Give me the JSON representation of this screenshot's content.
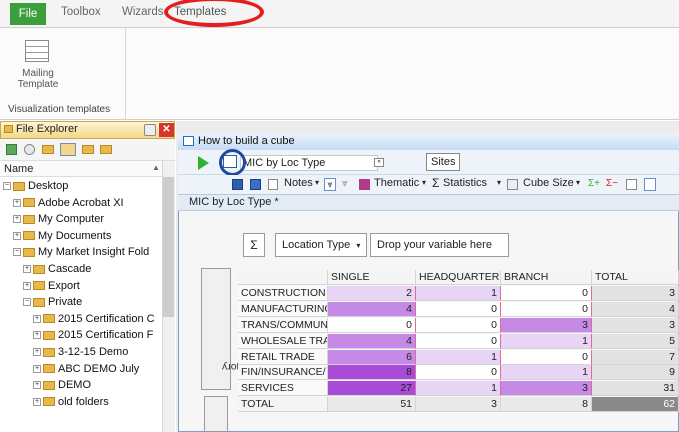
{
  "ribbon": {
    "tabs": [
      "File",
      "Toolbox",
      "Wizards",
      "Templates"
    ],
    "mailing_template_label": "Mailing Template",
    "group_label": "Visualization templates"
  },
  "file_explorer": {
    "title": "File Explorer",
    "column_header": "Name",
    "items": [
      {
        "label": "Desktop",
        "indent": 0,
        "expander": "−"
      },
      {
        "label": "Adobe Acrobat XI",
        "indent": 1,
        "expander": "+"
      },
      {
        "label": "My Computer",
        "indent": 1,
        "expander": "+"
      },
      {
        "label": "My Documents",
        "indent": 1,
        "expander": "+"
      },
      {
        "label": "My Market Insight Fold",
        "indent": 1,
        "expander": "−"
      },
      {
        "label": "Cascade",
        "indent": 2,
        "expander": "+"
      },
      {
        "label": "Export",
        "indent": 2,
        "expander": "+"
      },
      {
        "label": "Private",
        "indent": 2,
        "expander": "−"
      },
      {
        "label": "2015 Certification C",
        "indent": 3,
        "expander": "+"
      },
      {
        "label": "2015 Certification F",
        "indent": 3,
        "expander": "+"
      },
      {
        "label": "3-12-15 Demo",
        "indent": 3,
        "expander": "+"
      },
      {
        "label": "ABC DEMO July",
        "indent": 3,
        "expander": "+"
      },
      {
        "label": "DEMO",
        "indent": 3,
        "expander": "+"
      },
      {
        "label": "old folders",
        "indent": 3,
        "expander": "+"
      }
    ]
  },
  "cube_window": {
    "title": "How to build a cube",
    "cube_name": "MIC by Loc Type",
    "sites_button": "Sites",
    "toolbar": {
      "notes": "Notes",
      "thematic": "Thematic",
      "statistics": "Statistics",
      "cube_size": "Cube Size"
    },
    "subtitle": "MIC by Loc Type *",
    "sigma": "Σ",
    "location_type": "Location Type",
    "drop_label": "Drop your variable here",
    "row_axis_label": "Major Industry Category",
    "columns": [
      "SINGLE",
      "HEADQUARTERS",
      "BRANCH",
      "TOTAL"
    ],
    "rows": [
      {
        "label": "CONSTRUCTION",
        "values": [
          "2",
          "1",
          "0",
          "3"
        ]
      },
      {
        "label": "MANUFACTURING",
        "values": [
          "4",
          "0",
          "0",
          "4"
        ]
      },
      {
        "label": "TRANS/COMMUNICATIONS",
        "values": [
          "0",
          "0",
          "3",
          "3"
        ]
      },
      {
        "label": "WHOLESALE TRADE",
        "values": [
          "4",
          "0",
          "1",
          "5"
        ]
      },
      {
        "label": "RETAIL TRADE",
        "values": [
          "6",
          "1",
          "0",
          "7"
        ]
      },
      {
        "label": "FIN/INSURANCE/",
        "values": [
          "8",
          "0",
          "1",
          "9"
        ]
      },
      {
        "label": "SERVICES",
        "values": [
          "27",
          "1",
          "3",
          "31"
        ]
      },
      {
        "label": "TOTAL",
        "values": [
          "51",
          "3",
          "8",
          "62"
        ]
      }
    ]
  },
  "colors": {
    "file_tab": "#3c9e3c",
    "annotation_red": "#e41e1e",
    "annotation_blue": "#1e4a9e",
    "cell_dark": "#a94bd6",
    "cell_mid": "#c58ae6",
    "cell_light": "#e8d4f4"
  }
}
